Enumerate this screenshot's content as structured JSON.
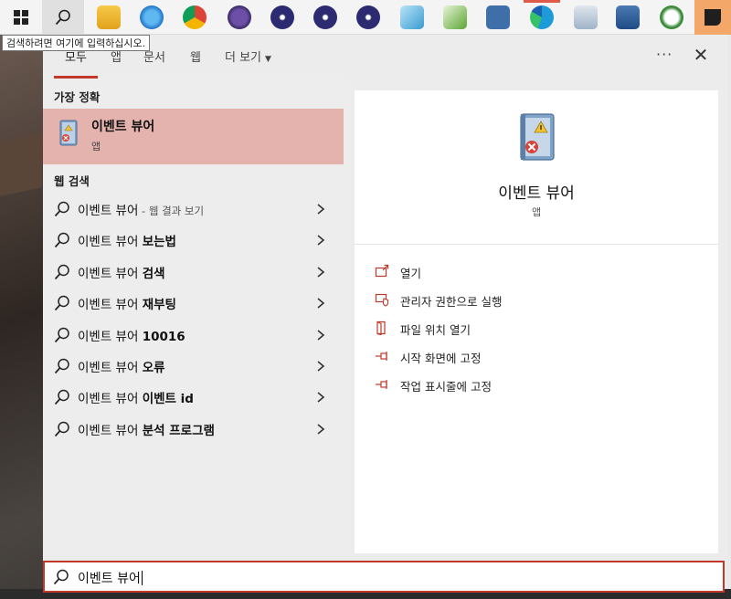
{
  "taskbar": {
    "tooltip": "검색하려면 여기에 입력하십시오."
  },
  "tabs": [
    {
      "label": "모두",
      "active": true
    },
    {
      "label": "앱"
    },
    {
      "label": "문서"
    },
    {
      "label": "웹"
    },
    {
      "label": "더 보기"
    }
  ],
  "best_match": {
    "heading": "가장 정확",
    "title": "이벤트 뷰어",
    "subtitle": "앱"
  },
  "web_search": {
    "heading": "웹 검색",
    "items": [
      {
        "prefix": "이벤트 뷰어",
        "bold": "",
        "hint": " - 웹 결과 보기"
      },
      {
        "prefix": "이벤트 뷰어 ",
        "bold": "보는법",
        "hint": ""
      },
      {
        "prefix": "이벤트 뷰어 ",
        "bold": "검색",
        "hint": ""
      },
      {
        "prefix": "이벤트 뷰어 ",
        "bold": "재부팅",
        "hint": ""
      },
      {
        "prefix": "이벤트 뷰어 ",
        "bold": "10016",
        "hint": ""
      },
      {
        "prefix": "이벤트 뷰어 ",
        "bold": "오류",
        "hint": ""
      },
      {
        "prefix": "이벤트 뷰어 ",
        "bold": "이벤트 id",
        "hint": ""
      },
      {
        "prefix": "이벤트 뷰어 ",
        "bold": "분석 프로그램",
        "hint": ""
      }
    ]
  },
  "detail": {
    "title": "이벤트 뷰어",
    "subtitle": "앱",
    "actions": [
      {
        "label": "열기",
        "icon": "open-icon"
      },
      {
        "label": "관리자 권한으로 실행",
        "icon": "shield-icon"
      },
      {
        "label": "파일 위치 열기",
        "icon": "file-location-icon"
      },
      {
        "label": "시작 화면에 고정",
        "icon": "pin-icon"
      },
      {
        "label": "작업 표시줄에 고정",
        "icon": "pin-icon"
      }
    ]
  },
  "search": {
    "query": "이벤트 뷰어"
  },
  "colors": {
    "accent": "#c0392b",
    "selected_bg": "#e4b3ae"
  }
}
